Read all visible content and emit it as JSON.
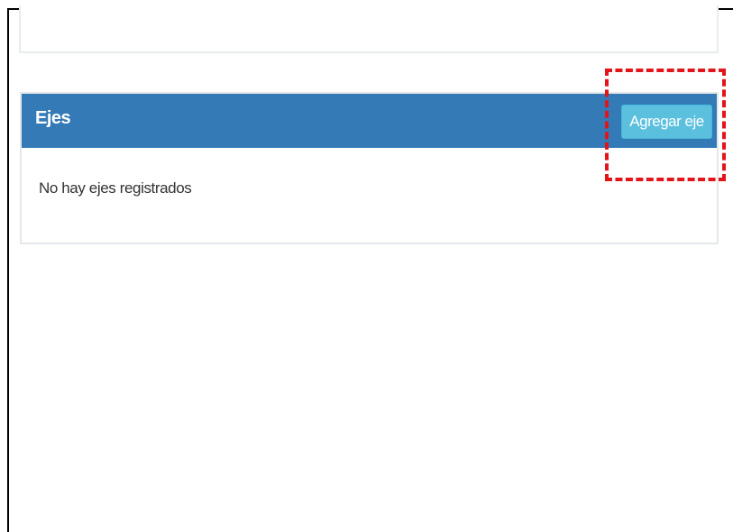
{
  "ejes_panel": {
    "title": "Ejes",
    "add_button_label": "Agregar eje",
    "empty_message": "No hay ejes registrados"
  },
  "colors": {
    "panel_header": "#337ab7",
    "add_button": "#5bc0de",
    "highlight": "#e4141b"
  }
}
